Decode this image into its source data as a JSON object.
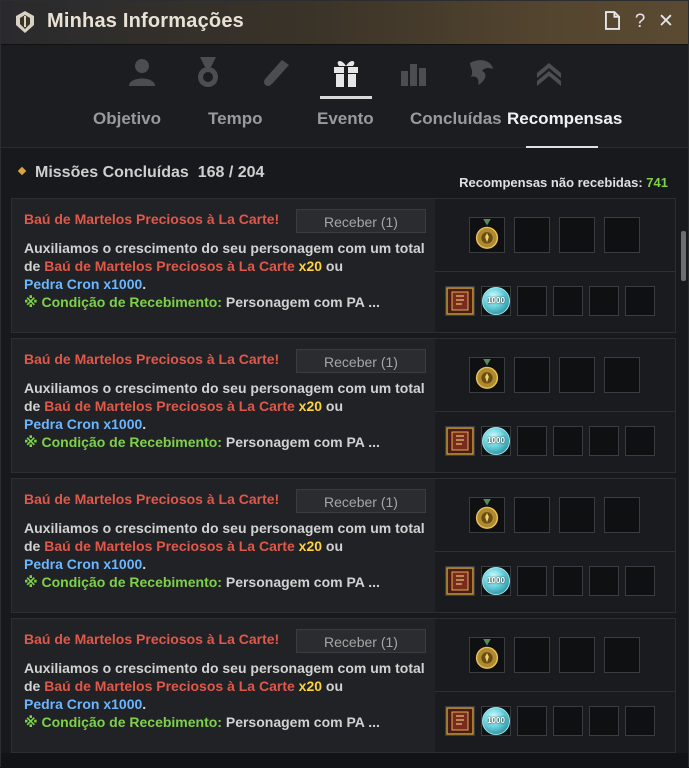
{
  "window": {
    "title": "Minhas Informações",
    "buttons": {
      "doc": "🗎",
      "help": "?",
      "close": "✕"
    }
  },
  "categories": [
    {
      "name": "person-icon",
      "active": false
    },
    {
      "name": "medal-icon",
      "active": false
    },
    {
      "name": "scroll-icon",
      "active": false
    },
    {
      "name": "gift-icon",
      "active": true
    },
    {
      "name": "bar-chart-icon",
      "active": false
    },
    {
      "name": "dragon-icon",
      "active": false
    },
    {
      "name": "rank-chevron-icon",
      "active": false
    }
  ],
  "tabs": [
    {
      "label": "Objetivo"
    },
    {
      "label": "Tempo"
    },
    {
      "label": "Evento"
    },
    {
      "label": "Concluídas"
    },
    {
      "label": "Recompensas"
    }
  ],
  "summary": {
    "label": "Missões Concluídas",
    "count": "168 / 204",
    "unreceived_label": "Recompensas não recebidas:",
    "unreceived_count": "741"
  },
  "missions": [
    {
      "title": "Baú de Martelos Preciosos à La Carte!",
      "button": "Receber (1)",
      "desc_prefix": "Auxiliamos o crescimento do seu personagem com um total de ",
      "desc_item": "Baú de Martelos Preciosos à La Carte",
      "desc_amount": "x20",
      "desc_or": " ou",
      "desc_item2": "Pedra Cron x1000",
      "desc_end": ".",
      "cond_label": "※ Condição de Recebimento:",
      "cond_value": "Personagem com PA ...",
      "cron_qty": "1000"
    },
    {
      "title": "Baú de Martelos Preciosos à La Carte!",
      "button": "Receber (1)",
      "desc_prefix": "Auxiliamos o crescimento do seu personagem com um total de ",
      "desc_item": "Baú de Martelos Preciosos à La Carte",
      "desc_amount": "x20",
      "desc_or": " ou",
      "desc_item2": "Pedra Cron x1000",
      "desc_end": ".",
      "cond_label": "※ Condição de Recebimento:",
      "cond_value": "Personagem com PA ...",
      "cron_qty": "1000"
    },
    {
      "title": "Baú de Martelos Preciosos à La Carte!",
      "button": "Receber (1)",
      "desc_prefix": "Auxiliamos o crescimento do seu personagem com um total de ",
      "desc_item": "Baú de Martelos Preciosos à La Carte",
      "desc_amount": "x20",
      "desc_or": " ou",
      "desc_item2": "Pedra Cron x1000",
      "desc_end": ".",
      "cond_label": "※ Condição de Recebimento:",
      "cond_value": "Personagem com PA ...",
      "cron_qty": "1000"
    },
    {
      "title": "Baú de Martelos Preciosos à La Carte!",
      "button": "Receber (1)",
      "desc_prefix": "Auxiliamos o crescimento do seu personagem com um total de ",
      "desc_item": "Baú de Martelos Preciosos à La Carte",
      "desc_amount": "x20",
      "desc_or": " ou",
      "desc_item2": "Pedra Cron x1000",
      "desc_end": ".",
      "cond_label": "※ Condição de Recebimento:",
      "cond_value": "Personagem com PA ...",
      "cron_qty": "1000"
    }
  ]
}
